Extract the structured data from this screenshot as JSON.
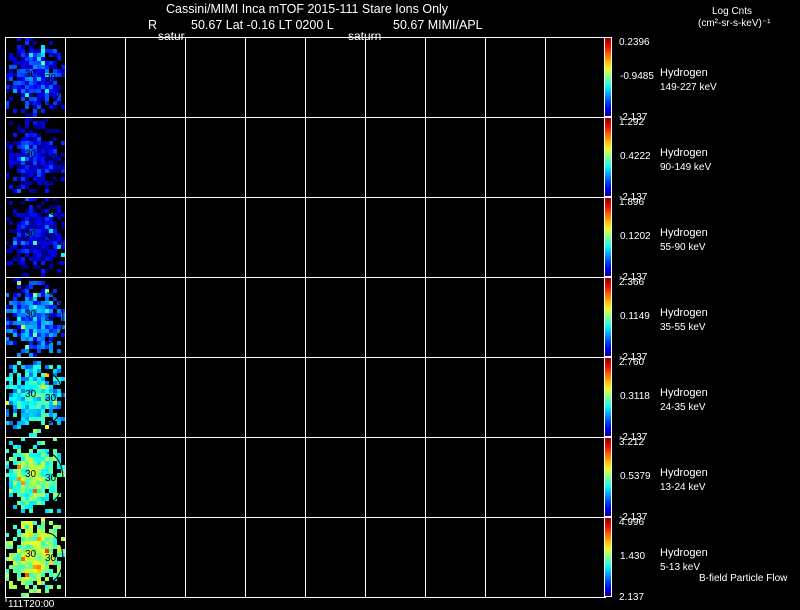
{
  "header": {
    "title": "Cassini/MIMI Inca mTOF  2015-111    Stare    Ions Only",
    "subtitle_r": "R",
    "subtitle_rest": "50.67  Lat -0.16  LT 0200  L",
    "subtitle_l": "50.67   MIMI/APL",
    "label_left": "satur",
    "label_mid": "saturn",
    "units_title": "Log Cnts",
    "units": "(cm²-sr-s-keV)⁻¹"
  },
  "footer": {
    "time": "111T20:00",
    "flow_note": "B-field Particle Flow"
  },
  "chart_data": {
    "type": "heatmap",
    "title": "Cassini/MIMI Inca mTOF  2015-111    Stare    Ions Only",
    "columns": 10,
    "time_label": "111T20:00",
    "colorbar_units": "Log Cnts (cm²-sr-s-keV)⁻¹",
    "panels": [
      {
        "species": "Hydrogen",
        "energy": "149-227 keV",
        "max": "0.2396",
        "mid": "-0.9485",
        "min": "-2.137",
        "level": 0.1,
        "markers": [
          "30",
          "30"
        ]
      },
      {
        "species": "Hydrogen",
        "energy": "90-149 keV",
        "max": "1.292",
        "mid": "0.4222",
        "min": "-2.137",
        "level": 0.06,
        "markers": [
          "30",
          "30"
        ]
      },
      {
        "species": "Hydrogen",
        "energy": "55-90 keV",
        "max": "1.896",
        "mid": "0.1202",
        "min": "-2.137",
        "level": 0.04,
        "markers": [
          "30",
          "30"
        ]
      },
      {
        "species": "Hydrogen",
        "energy": "35-55 keV",
        "max": "2.366",
        "mid": "0.1149",
        "min": "-2.137",
        "level": 0.18,
        "markers": [
          "30",
          "30"
        ]
      },
      {
        "species": "Hydrogen",
        "energy": "24-35 keV",
        "max": "2.760",
        "mid": "0.3118",
        "min": "-2.137",
        "level": 0.32,
        "markers": [
          "30",
          "30"
        ]
      },
      {
        "species": "Hydrogen",
        "energy": "13-24 keV",
        "max": "3.212",
        "mid": "0.5379",
        "min": "-2.137",
        "level": 0.42,
        "markers": [
          "30",
          "30"
        ]
      },
      {
        "species": "Hydrogen",
        "energy": "5-13 keV",
        "max": "4.996",
        "mid": "1.430",
        "min": "2.137",
        "level": 0.48,
        "markers": [
          "30",
          "30"
        ]
      }
    ]
  }
}
